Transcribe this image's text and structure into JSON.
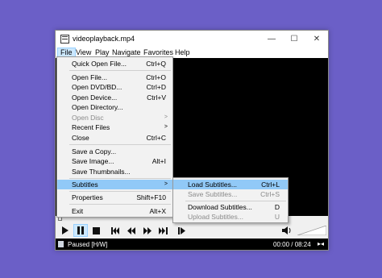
{
  "window": {
    "title": "videoplayback.mp4",
    "minimize_glyph": "—",
    "maximize_glyph": "☐",
    "close_glyph": "✕"
  },
  "menubar": [
    {
      "label": "File"
    },
    {
      "label": "View"
    },
    {
      "label": "Play"
    },
    {
      "label": "Navigate"
    },
    {
      "label": "Favorites"
    },
    {
      "label": "Help"
    }
  ],
  "file_menu": [
    {
      "label": "Quick Open File...",
      "shortcut": "Ctrl+Q"
    },
    {
      "label": "Open File...",
      "shortcut": "Ctrl+O"
    },
    {
      "label": "Open DVD/BD...",
      "shortcut": "Ctrl+D"
    },
    {
      "label": "Open Device...",
      "shortcut": "Ctrl+V"
    },
    {
      "label": "Open Directory...",
      "shortcut": ""
    },
    {
      "label": "Open Disc",
      "shortcut": ""
    },
    {
      "label": "Recent Files",
      "shortcut": ""
    },
    {
      "label": "Close",
      "shortcut": "Ctrl+C"
    },
    {
      "label": "Save a Copy...",
      "shortcut": ""
    },
    {
      "label": "Save Image...",
      "shortcut": "Alt+I"
    },
    {
      "label": "Save Thumbnails...",
      "shortcut": ""
    },
    {
      "label": "Subtitles",
      "shortcut": ""
    },
    {
      "label": "Properties",
      "shortcut": "Shift+F10"
    },
    {
      "label": "Exit",
      "shortcut": "Alt+X"
    }
  ],
  "subtitles_menu": [
    {
      "label": "Load Subtitles...",
      "shortcut": "Ctrl+L"
    },
    {
      "label": "Save Subtitles...",
      "shortcut": "Ctrl+S"
    },
    {
      "label": "Download Subtitles...",
      "shortcut": "D"
    },
    {
      "label": "Upload Subtitles...",
      "shortcut": "U"
    }
  ],
  "status": {
    "state": "Paused [H/W]",
    "time": "00:00 / 08:24"
  },
  "colors": {
    "desktop": "#6b5fc7",
    "menu_highlight": "#91c9f7",
    "pressed_button": "#cce8ff"
  },
  "icons": {
    "play": "play-icon",
    "pause": "pause-icon",
    "stop": "stop-icon",
    "prev": "skip-back-icon",
    "rewind": "rewind-icon",
    "forward": "fast-forward-icon",
    "next": "skip-forward-icon",
    "frame_step": "frame-step-icon",
    "volume": "volume-icon"
  }
}
